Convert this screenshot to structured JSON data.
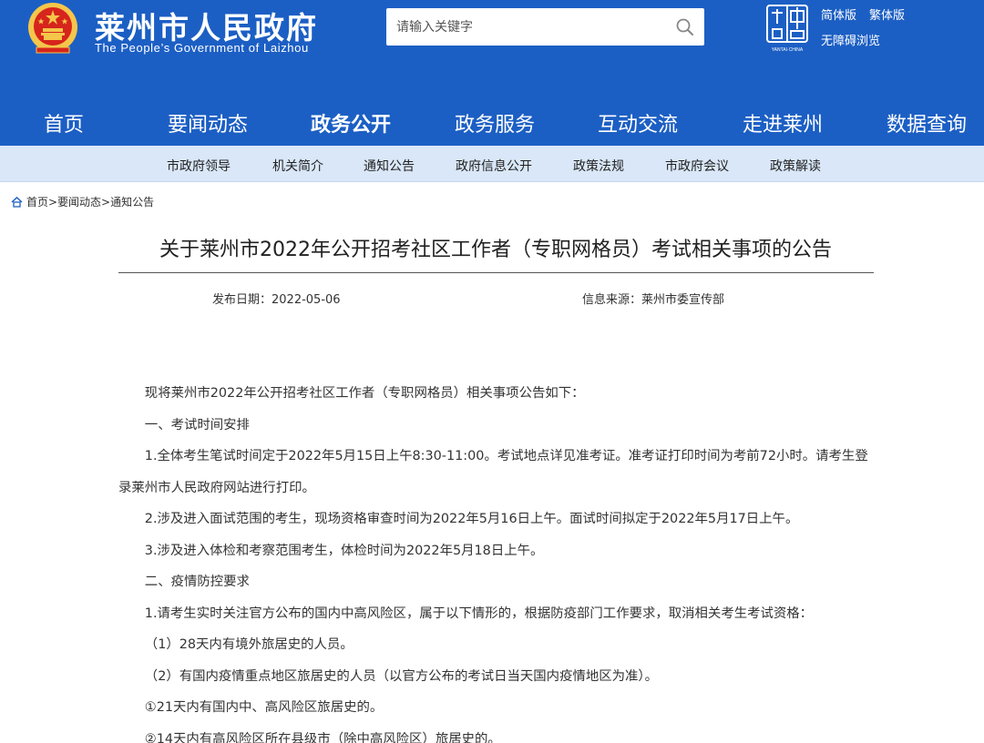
{
  "header": {
    "title": "莱州市人民政府",
    "subtitle": "The People’s Government of Laizhou",
    "search_placeholder": "请输入关键字",
    "lang_simplified": "简体版",
    "lang_traditional": "繁体版",
    "accessible": "无障碍浏览",
    "yantai_logo_text": "YANTAI·CHINA"
  },
  "main_nav": [
    {
      "label": "首页"
    },
    {
      "label": "要闻动态"
    },
    {
      "label": "政务公开",
      "active": true
    },
    {
      "label": "政务服务"
    },
    {
      "label": "互动交流"
    },
    {
      "label": "走进莱州"
    },
    {
      "label": "数据查询"
    }
  ],
  "sub_nav": [
    "市政府领导",
    "机关简介",
    "通知公告",
    "政府信息公开",
    "政策法规",
    "市政府会议",
    "政策解读"
  ],
  "breadcrumb": "首页>要闻动态>通知公告",
  "article": {
    "title": "关于莱州市2022年公开招考社区工作者（专职网格员）考试相关事项的公告",
    "date": "发布日期：2022-05-06",
    "source": "信息来源：莱州市委宣传部",
    "paragraphs": [
      "现将莱州市2022年公开招考社区工作者（专职网格员）相关事项公告如下：",
      "一、考试时间安排",
      "1.全体考生笔试时间定于2022年5月15日上午8:30-11:00。考试地点详见准考证。准考证打印时间为考前72小时。请考生登录莱州市人民政府网站进行打印。",
      "2.涉及进入面试范围的考生，现场资格审查时间为2022年5月16日上午。面试时间拟定于2022年5月17日上午。",
      "3.涉及进入体检和考察范围考生，体检时间为2022年5月18日上午。",
      "二、疫情防控要求",
      "1.请考生实时关注官方公布的国内中高风险区，属于以下情形的，根据防疫部门工作要求，取消相关考生考试资格：",
      "（1）28天内有境外旅居史的人员。",
      "（2）有国内疫情重点地区旅居史的人员（以官方公布的考试日当天国内疫情地区为准）。",
      "①21天内有国内中、高风险区旅居史的。",
      "②14天内有高风险区所在县级市（除中高风险区）旅居史的。"
    ]
  },
  "colors": {
    "brand_blue": "#1c5fc4",
    "subnav_bg": "#d9e7f8",
    "emblem_red": "#d6251c",
    "emblem_gold": "#f4c64a"
  }
}
